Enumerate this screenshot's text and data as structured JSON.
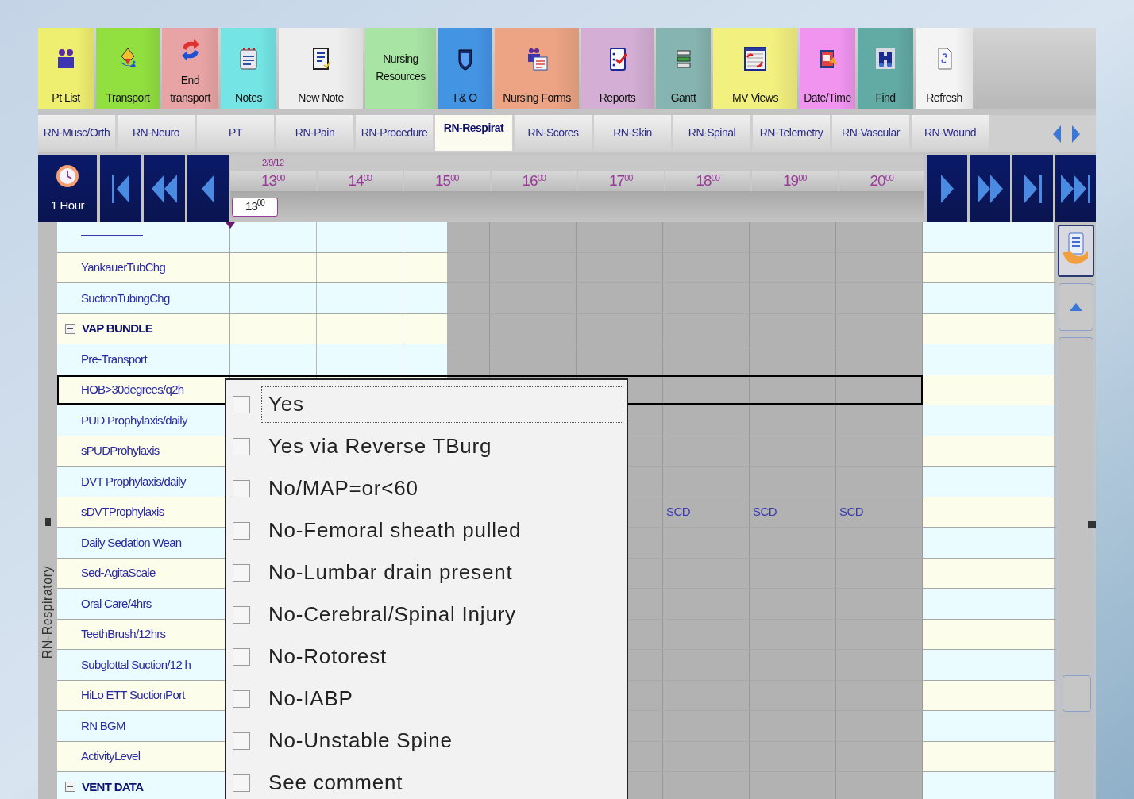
{
  "toolbar": [
    {
      "label": "Pt List",
      "color": "#eeee70",
      "kind": "people"
    },
    {
      "label": "Transport",
      "color": "#92e040",
      "kind": "diamond"
    },
    {
      "label": "End transport",
      "color": "#e8a4a4",
      "kind": "swap"
    },
    {
      "label": "Notes",
      "color": "#74e4e4",
      "kind": "notepad"
    },
    {
      "label": "New Note",
      "color": "#eeeeee",
      "kind": "document"
    },
    {
      "label": "Nursing Resources",
      "color": "#a8e4a4",
      "kind": "text"
    },
    {
      "label": "I & O",
      "color": "#4494e4",
      "kind": "shield"
    },
    {
      "label": "Nursing Forms",
      "color": "#eca484",
      "kind": "form"
    },
    {
      "label": "Reports",
      "color": "#d4aed4",
      "kind": "checklist"
    },
    {
      "label": "Gantt",
      "color": "#86b4b0",
      "kind": "bars"
    },
    {
      "label": "MV Views",
      "color": "#f2f07e",
      "kind": "window"
    },
    {
      "label": "Date/Time",
      "color": "#f094f0",
      "kind": "calendar"
    },
    {
      "label": "Find",
      "color": "#62aaa4",
      "kind": "binoculars"
    },
    {
      "label": "Refresh",
      "color": "#f4f4f4",
      "kind": "page"
    }
  ],
  "tabs": [
    {
      "label": "RN-Musc/Orth",
      "selected": false
    },
    {
      "label": "RN-Neuro",
      "selected": false
    },
    {
      "label": "PT",
      "selected": false
    },
    {
      "label": "RN-Pain",
      "selected": false
    },
    {
      "label": "RN-Procedure",
      "selected": false
    },
    {
      "label": "RN-Respirat",
      "selected": true
    },
    {
      "label": "RN-Scores",
      "selected": false
    },
    {
      "label": "RN-Skin",
      "selected": false
    },
    {
      "label": "RN-Spinal",
      "selected": false
    },
    {
      "label": "RN-Telemetry",
      "selected": false
    },
    {
      "label": "RN-Vascular",
      "selected": false
    },
    {
      "label": "RN-Wound",
      "selected": false
    }
  ],
  "timebar": {
    "interval": "1 Hour",
    "date": "2/9/12",
    "current": {
      "hour": "13",
      "minutes": "00"
    },
    "hours": [
      {
        "hour": "13",
        "minutes": "00"
      },
      {
        "hour": "14",
        "minutes": "00"
      },
      {
        "hour": "15",
        "minutes": "00"
      },
      {
        "hour": "16",
        "minutes": "00"
      },
      {
        "hour": "17",
        "minutes": "00"
      },
      {
        "hour": "18",
        "minutes": "00"
      },
      {
        "hour": "19",
        "minutes": "00"
      },
      {
        "hour": "20",
        "minutes": "00"
      }
    ]
  },
  "sidebar_label": "RN-Respiratory",
  "rows": [
    {
      "kind": "rule",
      "selected": false
    },
    {
      "kind": "item",
      "label": "YankauerTubChg",
      "selected": false
    },
    {
      "kind": "item",
      "label": "SuctionTubingChg",
      "selected": false
    },
    {
      "kind": "group",
      "label": "VAP BUNDLE",
      "selected": false
    },
    {
      "kind": "item",
      "label": "Pre-Transport",
      "selected": false
    },
    {
      "kind": "item",
      "label": "HOB>30degrees/q2h",
      "selected": true
    },
    {
      "kind": "item",
      "label": "PUD Prophylaxis/daily",
      "selected": false
    },
    {
      "kind": "item",
      "label": "sPUDProhylaxis",
      "selected": false
    },
    {
      "kind": "item",
      "label": "DVT Prophylaxis/daily",
      "selected": false
    },
    {
      "kind": "item",
      "label": "sDVTProphylaxis",
      "selected": false,
      "cells": [
        {
          "kind": "empty"
        },
        {
          "kind": "empty"
        },
        {
          "kind": "empty"
        },
        {
          "kind": "empty"
        },
        {
          "kind": "empty"
        },
        {
          "kind": "value",
          "text": "SCD"
        },
        {
          "kind": "value",
          "text": "SCD"
        },
        {
          "kind": "value",
          "text": "SCD"
        }
      ]
    },
    {
      "kind": "item",
      "label": "Daily Sedation Wean",
      "selected": false
    },
    {
      "kind": "item",
      "label": "Sed-AgitaScale",
      "selected": false
    },
    {
      "kind": "item",
      "label": "Oral Care/4hrs",
      "selected": false
    },
    {
      "kind": "item",
      "label": "TeethBrush/12hrs",
      "selected": false
    },
    {
      "kind": "item",
      "label": "Subglottal Suction/12 h",
      "selected": false
    },
    {
      "kind": "item",
      "label": "HiLo ETT SuctionPort",
      "selected": false
    },
    {
      "kind": "item",
      "label": "RN BGM",
      "selected": false
    },
    {
      "kind": "item",
      "label": "ActivityLevel",
      "selected": false
    },
    {
      "kind": "group",
      "label": "VENT DATA",
      "selected": false
    }
  ],
  "dropdown": {
    "options": [
      {
        "label": "Yes",
        "checked": false,
        "focused": true
      },
      {
        "label": "Yes via Reverse TBurg",
        "checked": false,
        "focused": false
      },
      {
        "label": "No/MAP=or<60",
        "checked": false,
        "focused": false
      },
      {
        "label": "No-Femoral sheath pulled",
        "checked": false,
        "focused": false
      },
      {
        "label": "No-Lumbar drain present",
        "checked": false,
        "focused": false
      },
      {
        "label": "No-Cerebral/Spinal Injury",
        "checked": false,
        "focused": false
      },
      {
        "label": "No-Rotorest",
        "checked": false,
        "focused": false
      },
      {
        "label": "No-IABP",
        "checked": false,
        "focused": false
      },
      {
        "label": "No-Unstable Spine",
        "checked": false,
        "focused": false
      },
      {
        "label": "See comment",
        "checked": false,
        "focused": false
      }
    ]
  }
}
